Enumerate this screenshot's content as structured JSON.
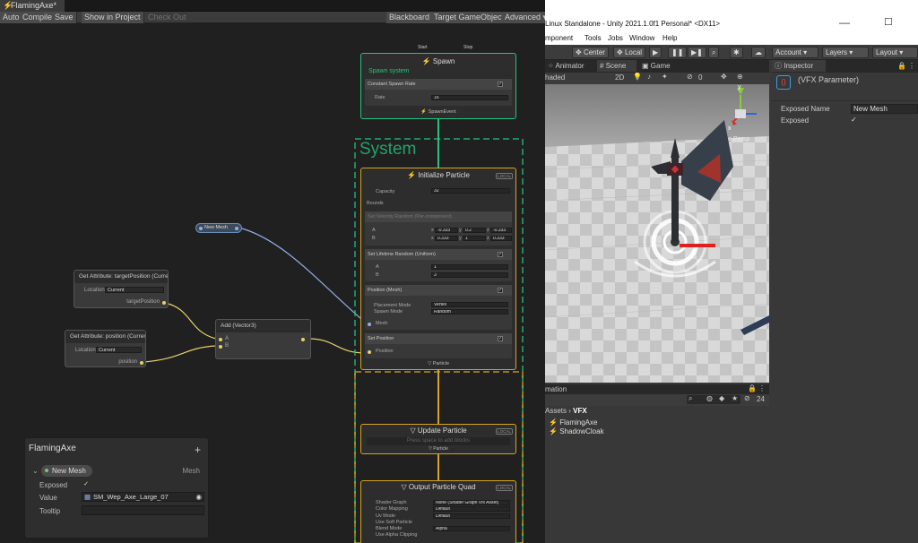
{
  "vfx": {
    "tab_title": "FlamingAxe*",
    "toolbar": {
      "auto": "Auto",
      "compile": "Compile",
      "save": "Save",
      "show_in_project": "Show in Project",
      "check_out": "Check Out",
      "blackboard": "Blackboard",
      "target_gameobject": "Target GameObject",
      "advanced": "Advanced"
    },
    "system_label": "System",
    "spawn": {
      "title": "Spawn",
      "start": "Start",
      "stop": "Stop",
      "subtitle": "Spawn system",
      "block": "Constant Spawn Rate",
      "rate_label": "Rate",
      "rate_value": "16",
      "out": "SpawnEvent"
    },
    "init": {
      "title": "Initialize Particle",
      "badge": "LOCAL",
      "capacity_label": "Capacity",
      "capacity_value": "32",
      "bounds_label": "Bounds",
      "velocity_block": "Set Velocity Random (Per-component)",
      "a_label": "A",
      "b_label": "B",
      "x_lbl": "x",
      "y_lbl": "y",
      "z_lbl": "z",
      "a_x": "-0.333",
      "a_y": "0.2",
      "a_z": "-0.333",
      "b_x": "0.333",
      "b_y": "1",
      "b_z": "0.333",
      "lifetime_block": "Set Lifetime Random (Uniform)",
      "life_a": "1",
      "life_b": "3",
      "position_block": "Position (Mesh)",
      "placement_label": "Placement Mode",
      "placement_value": "Vertex",
      "spawn_mode_label": "Spawn Mode",
      "spawn_mode_value": "Random",
      "mesh_label": "Mesh",
      "set_position_block": "Set Position",
      "set_position_label": "Position",
      "out": "Particle"
    },
    "update": {
      "title": "Update Particle",
      "badge": "LOCAL",
      "hint": "Press space to add blocks",
      "out": "Particle"
    },
    "output": {
      "title": "Output Particle Quad",
      "badge": "LOCAL",
      "rows": [
        {
          "label": "Shader Graph",
          "value": "None (Shader Graph Vfx Asset)"
        },
        {
          "label": "Color Mapping",
          "value": "Default"
        },
        {
          "label": "Uv Mode",
          "value": "Default"
        },
        {
          "label": "Use Soft Particle",
          "value": ""
        },
        {
          "label": "Blend Mode",
          "value": "Alpha"
        },
        {
          "label": "Use Alpha Clipping",
          "value": ""
        }
      ]
    },
    "mesh_property": {
      "label": "New Mesh"
    },
    "get_target": {
      "title": "Get Attribute: targetPosition (Curren",
      "location_label": "Location",
      "location_value": "Current",
      "out": "targetPosition"
    },
    "get_pos": {
      "title": "Get Attribute: position (Curren",
      "location_label": "Location",
      "location_value": "Current",
      "out": "position"
    },
    "add": {
      "title": "Add (Vector3)",
      "a": "A",
      "b": "B"
    },
    "blackboard": {
      "title": "FlamingAxe",
      "prop_name": "New Mesh",
      "prop_type": "Mesh",
      "exposed_label": "Exposed",
      "value_label": "Value",
      "value": "SM_Wep_Axe_Large_07",
      "tooltip_label": "Tooltip"
    }
  },
  "unity": {
    "title": "Linux Standalone - Unity 2021.1.0f1 Personal* <DX11>",
    "menu": [
      "mponent",
      "Tools",
      "Jobs",
      "Window",
      "Help"
    ],
    "toolbar": {
      "center": "Center",
      "local": "Local",
      "account": "Account",
      "layers": "Layers",
      "layout": "Layout"
    },
    "tabs": {
      "animator": "Animator",
      "scene": "Scene",
      "game": "Game",
      "inspector": "Inspector"
    },
    "scene_bar": {
      "shading": "haded",
      "mode": "2D",
      "count": "0"
    },
    "gizmo": {
      "y": "y",
      "x": "x",
      "persp": "< Persp"
    },
    "inspector": {
      "title": "(VFX Parameter)",
      "exposed_name_label": "Exposed Name",
      "exposed_name_value": "New Mesh",
      "exposed_label": "Exposed"
    },
    "project": {
      "tab": "mation",
      "crumb_assets": "Assets",
      "crumb_vfx": "VFX",
      "count": "24",
      "items": [
        "FlamingAxe",
        "ShadowCloak"
      ]
    }
  },
  "colors": {
    "spawn_green": "#25c27f",
    "system_gold": "#d7a320",
    "port_yellow": "#e6d16a",
    "port_blue": "#8fb0e6"
  }
}
